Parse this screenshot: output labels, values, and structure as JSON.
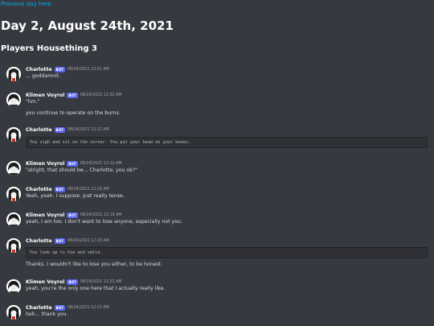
{
  "nav": {
    "previous_day": "Previous day here"
  },
  "page": {
    "day_title": "Day 2, August 24th, 2021",
    "channel_title": "Players Housething 3"
  },
  "bot_tag": "BOT",
  "messages": [
    {
      "author": "Charlotte",
      "avatar": "charlotte",
      "time": "08/24/2021 12:01 AM",
      "lines": [
        "... goddamnit."
      ]
    },
    {
      "author": "Klimen Voyrol",
      "avatar": "klimen",
      "time": "08/24/2021 12:02 AM",
      "lines": [
        "\"hm.\"",
        "you continue to operate on the burns."
      ]
    },
    {
      "author": "Charlotte",
      "avatar": "charlotte",
      "time": "08/24/2021 12:11 AM",
      "code": "You sigh and sit on the corner. You put your head on your knees."
    },
    {
      "author": "Klimen Voyrol",
      "avatar": "klimen",
      "time": "08/24/2021 12:12 AM",
      "lines": [
        "\"alright, that should be... Charlotte, you ok?\""
      ]
    },
    {
      "author": "Charlotte",
      "avatar": "charlotte",
      "time": "08/24/2021 12:19 AM",
      "lines": [
        "Yeah, yeah. I suppose. Just really tense."
      ]
    },
    {
      "author": "Klimen Voyrol",
      "avatar": "klimen",
      "time": "08/24/2021 12:19 AM",
      "lines": [
        "yeah, I am too. I don't want to lose anyone, especially not you."
      ]
    },
    {
      "author": "Charlotte",
      "avatar": "charlotte",
      "time": "08/24/2021 12:20 AM",
      "code": "You look up to him and smile.",
      "lines": [
        "Thanks. I wouldn't like to lose you either, to be honest."
      ]
    },
    {
      "author": "Klimen Voyrol",
      "avatar": "klimen",
      "time": "08/24/2021 12:22 AM",
      "lines": [
        "yeah, you're the only one here that I actually really like."
      ]
    },
    {
      "author": "Charlotte",
      "avatar": "charlotte",
      "time": "08/24/2021 12:23 AM",
      "lines": [
        "heh... thank you."
      ]
    }
  ]
}
